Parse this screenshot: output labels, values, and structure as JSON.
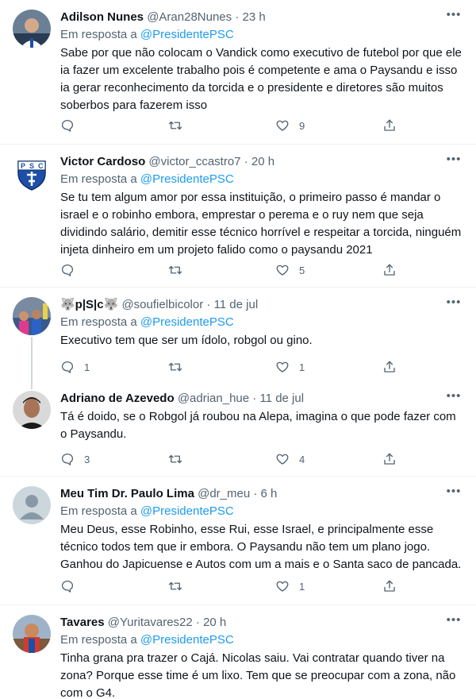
{
  "colors": {
    "accent": "#1d9bf0",
    "text": "#0f1419",
    "muted": "#536471",
    "border": "#eff3f4"
  },
  "tweets": [
    {
      "name": "Adilson Nunes",
      "handle": "@Aran28Nunes",
      "time": "23 h",
      "reply_prefix": "Em resposta a",
      "reply_to": "@PresidentePSC",
      "text": "Sabe por que não colocam o Vandick como executivo de futebol por que ele ia fazer um excelente trabalho pois é competente e ama o Paysandu e isso ia gerar reconhecimento da torcida e o presidente e diretores são muitos soberbos para fazerem isso",
      "replies": "",
      "retweets": "",
      "likes": "9"
    },
    {
      "name": "Victor Cardoso",
      "handle": "@victor_ccastro7",
      "time": "20 h",
      "reply_prefix": "Em resposta a",
      "reply_to": "@PresidentePSC",
      "text": "Se tu tem algum amor por essa instituição, o primeiro passo é mandar o israel e o robinho embora, emprestar o perema e o ruy nem que seja dividindo salário, demitir esse técnico horrível e respeitar a torcida, ninguém injeta dinheiro em um projeto falido como o paysandu 2021",
      "replies": "",
      "retweets": "",
      "likes": "5"
    },
    {
      "name": "🐺p|S|c🐺",
      "handle": "@soufielbicolor",
      "time": "11 de jul",
      "reply_prefix": "Em resposta a",
      "reply_to": "@PresidentePSC",
      "text": "Executivo tem que ser um ídolo, robgol ou gino.",
      "replies": "1",
      "retweets": "",
      "likes": "1"
    },
    {
      "name": "Adriano de Azevedo",
      "handle": "@adrian_hue",
      "time": "11 de jul",
      "reply_prefix": "",
      "reply_to": "",
      "text": "Tá é doido, se o Robgol já roubou na Alepa, imagina o que pode fazer com o Paysandu.",
      "replies": "3",
      "retweets": "",
      "likes": "4"
    },
    {
      "name": "Meu Tim Dr. Paulo Lima",
      "handle": "@dr_meu",
      "time": "6 h",
      "reply_prefix": "Em resposta a",
      "reply_to": "@PresidentePSC",
      "text": "Meu Deus, esse Robinho, esse Rui, esse Israel, e principalmente esse técnico todos tem que ir embora. O Paysandu não tem um plano jogo. Ganhou do Japicuense e Autos com um a mais e o Santa saco de pancada.",
      "replies": "",
      "retweets": "",
      "likes": "1"
    },
    {
      "name": "Tavares",
      "handle": "@Yuritavares22",
      "time": "20 h",
      "reply_prefix": "Em resposta a",
      "reply_to": "@PresidentePSC",
      "text": "Tinha grana pra trazer o Cajá. Nicolas saiu. Vai contratar quando tiver na zona? Porque esse time é um lixo. Tem que se preocupar com a zona, não com o G4.",
      "replies": "",
      "retweets": "",
      "likes": ""
    }
  ]
}
